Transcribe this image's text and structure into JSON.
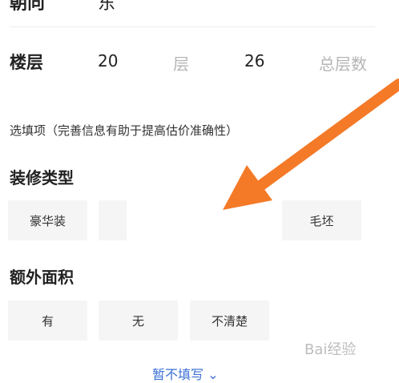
{
  "partial_row": {
    "label": "朝向",
    "value": "东"
  },
  "floor": {
    "label": "楼层",
    "floor_value": "20",
    "floor_unit": "层",
    "total_value": "26",
    "total_unit": "总层数"
  },
  "optional_hint": "选填项（完善信息有助于提高估价准确性）",
  "decoration": {
    "title": "装修类型",
    "options": [
      "豪华装",
      "",
      "",
      "毛坯"
    ]
  },
  "extra_area": {
    "title": "额外面积",
    "options": [
      "有",
      "无",
      "不清楚"
    ]
  },
  "bottom_link": "暂不填写",
  "watermark": "Bai经验",
  "colors": {
    "arrow": "#f47a28",
    "chip_bg": "#f5f5f5",
    "placeholder": "#b5b5b5",
    "link": "#3a6fd6"
  }
}
